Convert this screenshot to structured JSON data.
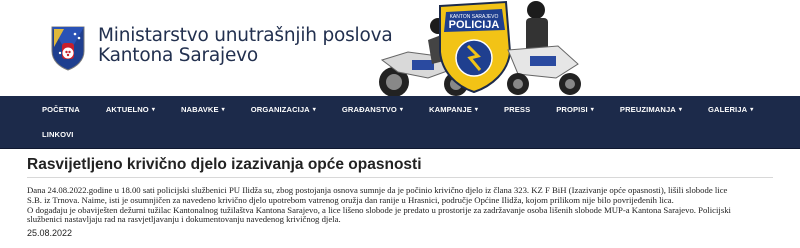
{
  "header": {
    "title_line1": "Ministarstvo unutrašnjih poslova",
    "title_line2": "Kantona Sarajevo",
    "badge_text": "POLICIJA",
    "badge_top_text": "KANTON SARAJEVO"
  },
  "nav": {
    "row1": [
      {
        "label": "POČETNA",
        "dropdown": false
      },
      {
        "label": "AKTUELNO",
        "dropdown": true
      },
      {
        "label": "NABAVKE",
        "dropdown": true
      },
      {
        "label": "ORGANIZACIJA",
        "dropdown": true
      },
      {
        "label": "GRAĐANSTVO",
        "dropdown": true
      },
      {
        "label": "KAMPANJE",
        "dropdown": true
      },
      {
        "label": "PRESS",
        "dropdown": false
      },
      {
        "label": "PROPISI",
        "dropdown": true
      },
      {
        "label": "PREUZIMANJA",
        "dropdown": true
      },
      {
        "label": "GALERIJA",
        "dropdown": true
      }
    ],
    "row2": [
      {
        "label": "LINKOVI",
        "dropdown": false
      }
    ],
    "caret": "▾"
  },
  "article": {
    "title": "Rasvijetljeno krivično djelo izazivanja opće opasnosti",
    "lines": [
      "Dana 24.08.2022.godine u 18.00 sati policijski službenici PU Ilidža su, zbog postojanja osnova sumnje da je počinio krivično djelo iz člana 323. KZ F BiH (Izazivanje opće opasnosti), lišili slobode lice",
      "S.B. iz Trnova. Naime, isti je osumnjičen za navedeno krivično djelo upotrebom vatrenog oružja dan ranije u Hrasnici, područje Općine Ilidža, kojom prilikom nije bilo povrijeđenih lica.",
      "O događaju je obaviješten dežurni tužilac Kantonalnog tužilaštva Kantona Sarajevo, a lice lišeno slobode je predato u prostorije za zadržavanje osoba lišenih slobode MUP-a Kantona Sarajevo. Policijski",
      "službenici nastavljaju rad na rasvjetljavanju i dokumentovanju navedenog krivičnog djela."
    ],
    "date": "25.08.2022"
  },
  "colors": {
    "nav_bg": "#1c2a4a",
    "title_color": "#22304f",
    "badge_yellow": "#f2c316",
    "crest_blue": "#1f3f8f"
  }
}
